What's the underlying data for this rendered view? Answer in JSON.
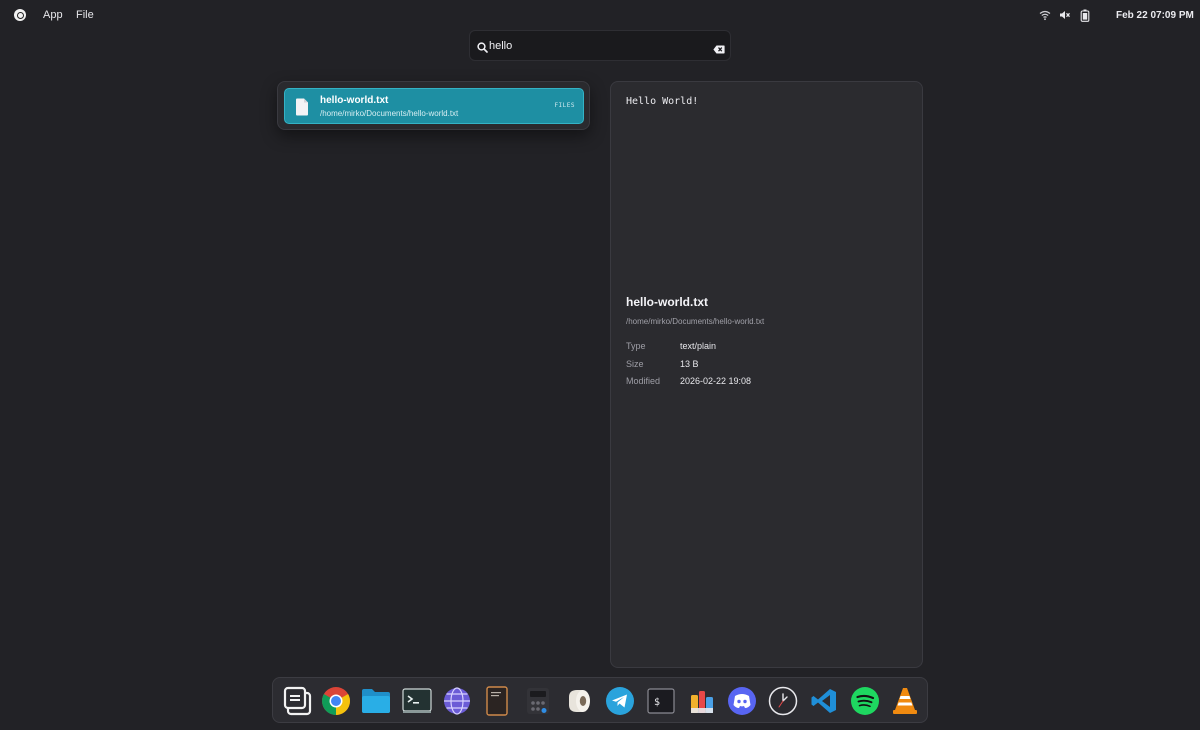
{
  "topbar": {
    "menu": [
      "App",
      "File"
    ],
    "clock": "Feb 22  07:09 PM",
    "tray_icons": [
      "wifi-icon",
      "volume-muted-icon",
      "battery-icon"
    ]
  },
  "search": {
    "value": "hello",
    "icon": "search-icon",
    "clear_icon": "backspace-icon"
  },
  "results": [
    {
      "name": "hello-world.txt",
      "path": "/home/mirko/Documents/hello-world.txt",
      "tag": "FILES",
      "icon": "file-icon",
      "selected": true
    }
  ],
  "preview": {
    "content": "Hello World!",
    "name": "hello-world.txt",
    "path": "/home/mirko/Documents/hello-world.txt",
    "meta": [
      {
        "key": "Type",
        "value": "text/plain"
      },
      {
        "key": "Size",
        "value": "13 B"
      },
      {
        "key": "Modified",
        "value": "2026-02-22 19:08"
      }
    ]
  },
  "dock": {
    "apps": [
      "launcher-icon",
      "chrome-icon",
      "files-icon",
      "terminal-icon",
      "browser-globe-icon",
      "notes-icon",
      "calculator-icon",
      "toilet-paper-icon",
      "telegram-icon",
      "shell-icon",
      "paint-icon",
      "discord-icon",
      "clock-icon",
      "vscode-icon",
      "spotify-icon",
      "vlc-icon"
    ]
  },
  "colors": {
    "background": "#222226",
    "accent": "#1e8fa3",
    "panel": "#2b2b2f"
  }
}
